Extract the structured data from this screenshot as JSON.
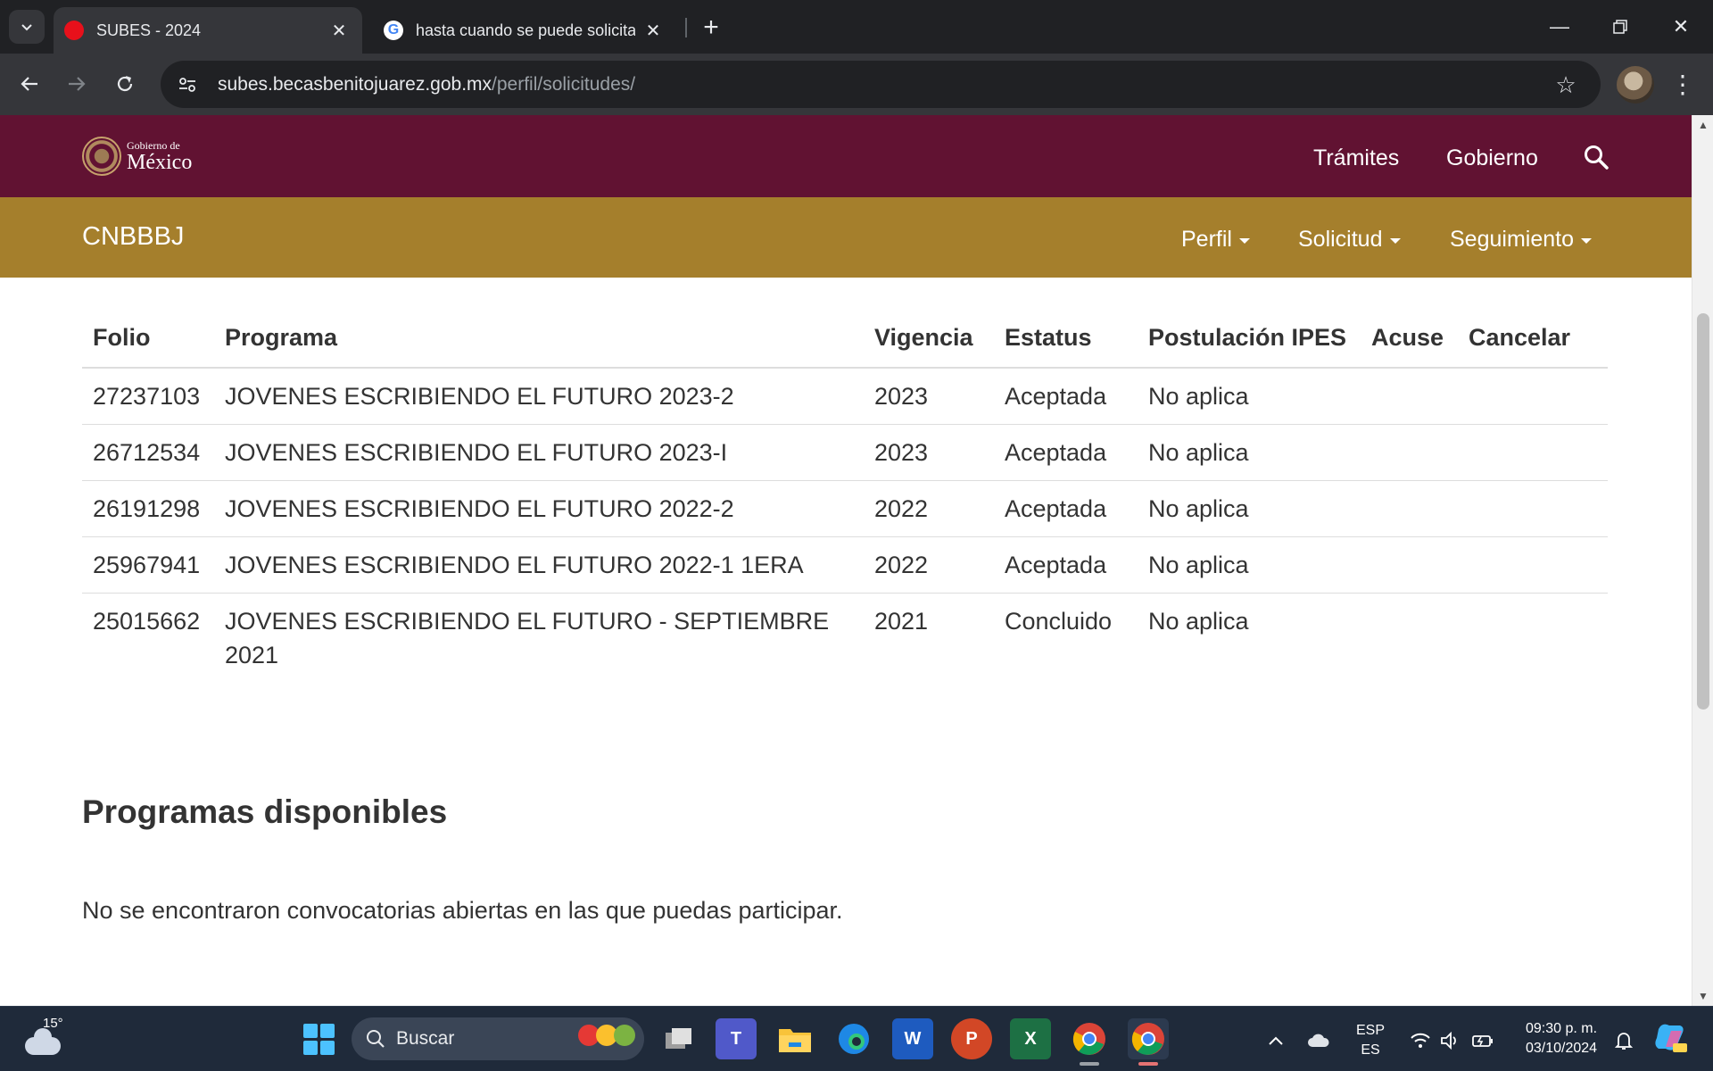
{
  "browser": {
    "tabs": [
      {
        "title": "SUBES - 2024",
        "active": true
      },
      {
        "title": "hasta cuando se puede solicitar",
        "active": false
      }
    ],
    "url_host": "subes.becasbenitojuarez.gob.mx",
    "url_path": "/perfil/solicitudes/",
    "icons": {
      "back": "arrow-left-icon",
      "forward": "arrow-right-icon",
      "reload": "reload-icon",
      "bookmark": "star-icon",
      "menu": "kebab-menu-icon"
    }
  },
  "gov_header": {
    "logo_small": "Gobierno de",
    "logo_big": "México",
    "menu": [
      "Trámites",
      "Gobierno"
    ],
    "color": "#611232"
  },
  "sub_header": {
    "brand": "CNBBBJ",
    "menu": [
      "Perfil",
      "Solicitud",
      "Seguimiento"
    ],
    "color": "#a57f2c"
  },
  "requests_table": {
    "headers": [
      "Folio",
      "Programa",
      "Vigencia",
      "Estatus",
      "Postulación IPES",
      "Acuse",
      "Cancelar"
    ],
    "rows": [
      {
        "folio": "27237103",
        "programa": "JOVENES ESCRIBIENDO EL FUTURO 2023-2",
        "vigencia": "2023",
        "estatus": "Aceptada",
        "postulacion": "No aplica"
      },
      {
        "folio": "26712534",
        "programa": "JOVENES ESCRIBIENDO EL FUTURO 2023-I",
        "vigencia": "2023",
        "estatus": "Aceptada",
        "postulacion": "No aplica"
      },
      {
        "folio": "26191298",
        "programa": "JOVENES ESCRIBIENDO EL FUTURO 2022-2",
        "vigencia": "2022",
        "estatus": "Aceptada",
        "postulacion": "No aplica"
      },
      {
        "folio": "25967941",
        "programa": "JOVENES ESCRIBIENDO EL FUTURO 2022-1 1ERA",
        "vigencia": "2022",
        "estatus": "Aceptada",
        "postulacion": "No aplica"
      },
      {
        "folio": "25015662",
        "programa": "JOVENES ESCRIBIENDO EL FUTURO - SEPTIEMBRE 2021",
        "vigencia": "2021",
        "estatus": "Concluido",
        "postulacion": "No aplica"
      }
    ]
  },
  "available": {
    "title": "Programas disponibles",
    "message": "No se encontraron convocatorias abiertas en las que puedas participar."
  },
  "taskbar": {
    "weather_temp": "15°",
    "search_placeholder": "Buscar",
    "lang_top": "ESP",
    "lang_bottom": "ES",
    "time": "09:30 p. m.",
    "date": "03/10/2024"
  }
}
